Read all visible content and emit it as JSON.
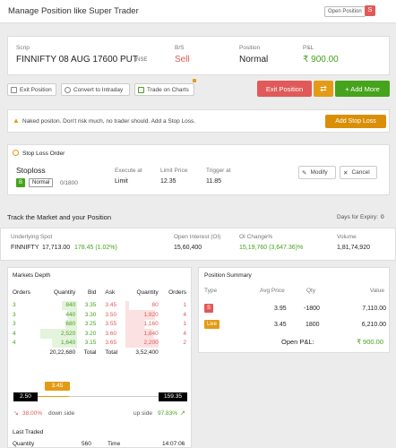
{
  "header": {
    "title": "Manage Position like Super Trader",
    "open_position": "Open Position",
    "badge": "S"
  },
  "position": {
    "scrip_label": "Scrip",
    "scrip": "FINNIFTY 08 AUG 17600 PUT",
    "exchange": "NSE",
    "bs_label": "B/S",
    "bs": "Sell",
    "type_label": "Position",
    "type": "Normal",
    "pnl_label": "P&L",
    "pnl": "₹ 900.00"
  },
  "toolbar": {
    "exit_position": "Exit Position",
    "convert": "Convert to Intraday",
    "trade_charts": "Trade on Charts",
    "exit_btn": "Exit Position",
    "add_more": "+ Add More"
  },
  "warning": {
    "text": "Naked positon. Don't risk much, no trader should. Add a Stop Loss.",
    "button": "Add Stop Loss"
  },
  "stoploss": {
    "title": "Stop Loss Order",
    "name": "Stoploss",
    "side": "B",
    "type": "Normal",
    "qty": "0/1800",
    "exec_label": "Execute at",
    "exec": "Limit",
    "limit_label": "Limit Price",
    "limit": "12.35",
    "trigger_label": "Trigger at",
    "trigger": "11.85",
    "modify": "Modify",
    "cancel": "Cancel"
  },
  "track": {
    "title": "Track the Market and your Position",
    "expiry_label": "Days for Expiry:",
    "expiry": "0"
  },
  "market": {
    "spot_label": "Underlying Spot",
    "spot_name": "FINNIFTY",
    "spot_value": "17,713.00",
    "spot_change": "178.45 (1.02%)",
    "oi_label": "Open Interest (OI)",
    "oi": "15,60,400",
    "oic_label": "OI Change%",
    "oic": "15,19,760 (3,647.36)%",
    "vol_label": "Volume",
    "vol": "1,81,74,920"
  },
  "depth": {
    "title": "Markets Depth",
    "headers": [
      "Orders",
      "Quantity",
      "Bid",
      "Ask",
      "Quantity",
      "Orders"
    ],
    "rows": [
      [
        "3",
        "840",
        "3.35",
        "3.45",
        "80",
        "1"
      ],
      [
        "3",
        "440",
        "3.30",
        "3.50",
        "1,920",
        "4"
      ],
      [
        "3",
        "680",
        "3.25",
        "3.55",
        "1,160",
        "1"
      ],
      [
        "4",
        "2,520",
        "3.20",
        "3.60",
        "1,840",
        "4"
      ],
      [
        "4",
        "1,640",
        "3.15",
        "3.65",
        "2,200",
        "2"
      ]
    ],
    "total_bid": "20,22,680",
    "total_label": "Total",
    "total_label2": "Total",
    "total_ask": "3,52,400",
    "low": "2.50",
    "current": "3.45",
    "high": "159.35",
    "down_pct": "38.00%",
    "down_label": "down side",
    "up_label": "up side",
    "up_pct": "97.83%",
    "last_traded": "Last Traded",
    "qty_label": "Quantity",
    "qty": "560",
    "time_label": "Time",
    "time": "14:07:06"
  },
  "summary": {
    "title": "Position Summary",
    "headers": [
      "Type",
      "Avg Price",
      "Qty",
      "Value"
    ],
    "rows": [
      {
        "type": "S",
        "avg": "3.95",
        "qty": "-1800",
        "value": "7,110.00"
      },
      {
        "type": "Live",
        "avg": "3.45",
        "qty": "1800",
        "value": "6,210.00"
      }
    ],
    "open_pnl_label": "Open P&L:",
    "open_pnl": "₹ 900.00"
  },
  "colors": {
    "red": "#e05a59",
    "green": "#46a31c",
    "orange": "#e39b16",
    "gold": "#d98f07"
  }
}
